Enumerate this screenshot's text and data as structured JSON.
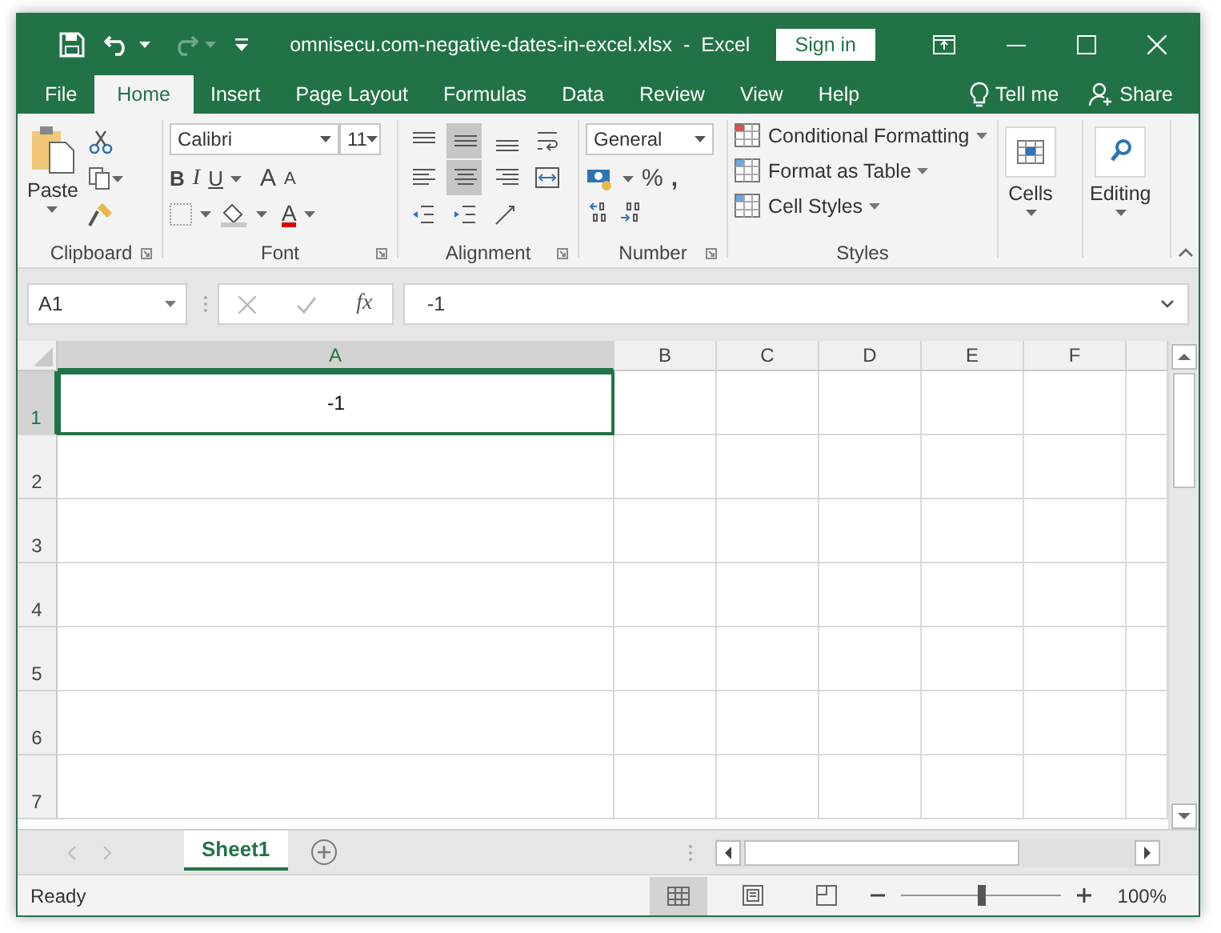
{
  "window": {
    "title": "omnisecu.com-negative-dates-in-excel.xlsx  -  Excel",
    "sign_in": "Sign in"
  },
  "tabs": [
    {
      "label": "File",
      "selected": false
    },
    {
      "label": "Home",
      "selected": true
    },
    {
      "label": "Insert",
      "selected": false
    },
    {
      "label": "Page Layout",
      "selected": false
    },
    {
      "label": "Formulas",
      "selected": false
    },
    {
      "label": "Data",
      "selected": false
    },
    {
      "label": "Review",
      "selected": false
    },
    {
      "label": "View",
      "selected": false
    },
    {
      "label": "Help",
      "selected": false
    }
  ],
  "tell_me": "Tell me",
  "share": "Share",
  "ribbon": {
    "clipboard": {
      "label": "Clipboard",
      "paste": "Paste"
    },
    "font": {
      "label": "Font",
      "name": "Calibri",
      "size": "11",
      "bold": "B",
      "italic": "I",
      "underline": "U",
      "grow": "A",
      "shrink": "A",
      "font_color_letter": "A"
    },
    "alignment": {
      "label": "Alignment",
      "vertical": [
        {
          "kind": "top",
          "selected": false
        },
        {
          "kind": "middle",
          "selected": true
        },
        {
          "kind": "bottom",
          "selected": false
        }
      ],
      "horizontal": [
        {
          "kind": "left",
          "selected": false
        },
        {
          "kind": "center",
          "selected": true
        },
        {
          "kind": "right",
          "selected": false
        }
      ]
    },
    "number": {
      "label": "Number",
      "format": "General",
      "percent": "%",
      "comma": ","
    },
    "styles": {
      "label": "Styles",
      "items": [
        "Conditional Formatting",
        "Format as Table",
        "Cell Styles"
      ]
    },
    "cells": {
      "label": "Cells"
    },
    "editing": {
      "label": "Editing"
    }
  },
  "formula_bar": {
    "name_box": "A1",
    "fx": "fx",
    "formula": "-1"
  },
  "grid": {
    "columns": [
      {
        "label": "A",
        "selected": true
      },
      {
        "label": "B",
        "selected": false
      },
      {
        "label": "C",
        "selected": false
      },
      {
        "label": "D",
        "selected": false
      },
      {
        "label": "E",
        "selected": false
      },
      {
        "label": "F",
        "selected": false
      }
    ],
    "rows": [
      {
        "label": "1",
        "selected": true,
        "cells": [
          "-1"
        ]
      },
      {
        "label": "2",
        "selected": false
      },
      {
        "label": "3",
        "selected": false
      },
      {
        "label": "4",
        "selected": false
      },
      {
        "label": "5",
        "selected": false
      },
      {
        "label": "6",
        "selected": false
      },
      {
        "label": "7",
        "selected": false
      }
    ]
  },
  "sheets": [
    {
      "label": "Sheet1",
      "selected": true
    }
  ],
  "status_bar": {
    "text": "Ready",
    "views": [
      {
        "kind": "normal",
        "selected": true
      },
      {
        "kind": "page_layout",
        "selected": false
      },
      {
        "kind": "page_break",
        "selected": false
      }
    ],
    "zoom_slider": {
      "level": 0.5
    },
    "zoom": "100%"
  }
}
